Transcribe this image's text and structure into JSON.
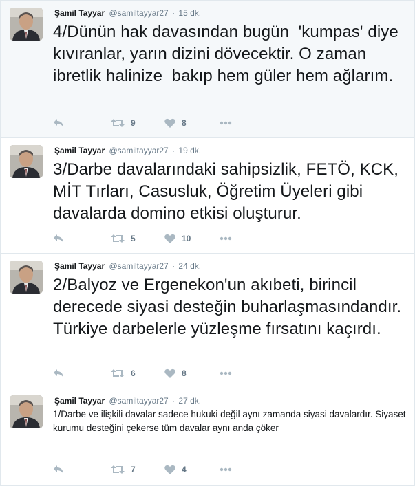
{
  "tweets": [
    {
      "name": "Şamil Tayyar",
      "handle": "@samiltayyar27",
      "separator": "·",
      "time": "15 dk.",
      "text": "4/Dünün hak davasından bugün  'kumpas' diye kıvıranlar, yarın dizini dövecektir. O zaman ibretlik halinize  bakıp hem güler hem ağlarım.",
      "retweets": "9",
      "likes": "8"
    },
    {
      "name": "Şamil Tayyar",
      "handle": "@samiltayyar27",
      "separator": "·",
      "time": "19 dk.",
      "text": "3/Darbe davalarındaki sahipsizlik, FETÖ, KCK, MİT Tırları, Casusluk, Öğretim Üyeleri gibi davalarda domino etkisi oluşturur.",
      "retweets": "5",
      "likes": "10"
    },
    {
      "name": "Şamil Tayyar",
      "handle": "@samiltayyar27",
      "separator": "·",
      "time": "24 dk.",
      "text": "2/Balyoz ve Ergenekon'un akıbeti, birincil derecede siyasi desteğin buharlaşmasındandır. Türkiye darbelerle yüzleşme fırsatını kaçırdı.",
      "retweets": "6",
      "likes": "8"
    },
    {
      "name": "Şamil Tayyar",
      "handle": "@samiltayyar27",
      "separator": "·",
      "time": "27 dk.",
      "text": "1/Darbe ve ilişkili davalar sadece hukuki değil aynı zamanda siyasi davalardır. Siyaset kurumu desteğini çekerse tüm davalar aynı anda çöker",
      "retweets": "7",
      "likes": "4"
    }
  ],
  "icons": {
    "reply": "reply-icon",
    "retweet": "retweet-icon",
    "like": "heart-icon",
    "more": "more-icon"
  },
  "colors": {
    "icon": "#aab8c2",
    "secondary_text": "#657786",
    "highlight_bg": "#f5f8fa"
  }
}
